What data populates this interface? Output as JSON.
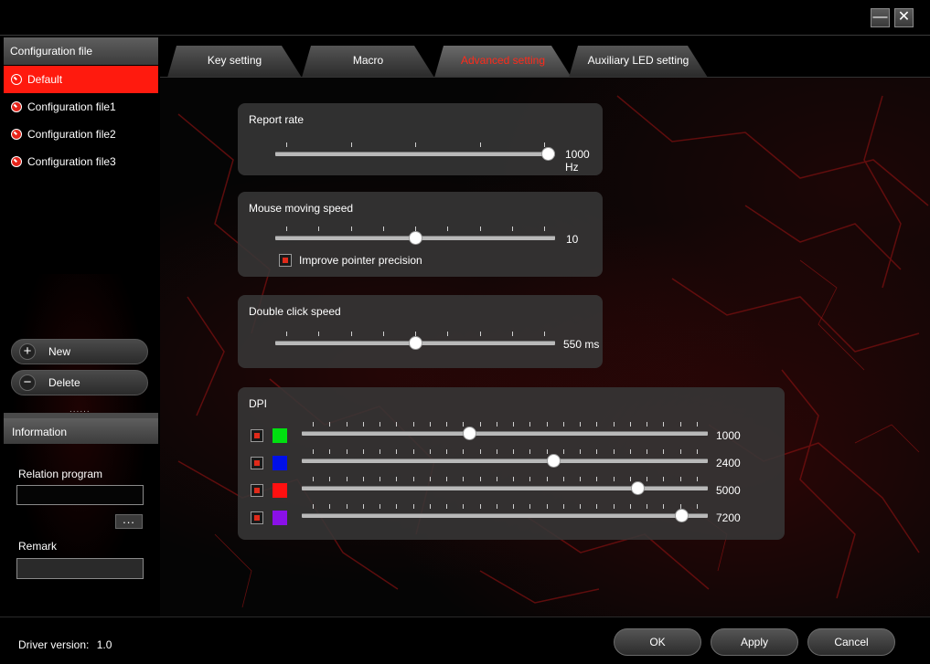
{
  "window": {
    "minimize_label": "—",
    "close_label": "✕"
  },
  "sidebar": {
    "header": "Configuration file",
    "items": [
      {
        "label": "Default",
        "active": true
      },
      {
        "label": "Configuration file1",
        "active": false
      },
      {
        "label": "Configuration file2",
        "active": false
      },
      {
        "label": "Configuration file3",
        "active": false
      }
    ],
    "new_label": "New",
    "delete_label": "Delete",
    "new_icon": "+",
    "delete_icon": "−"
  },
  "information": {
    "header": "Information",
    "relation_label": "Relation program",
    "relation_value": "",
    "browse_label": "...",
    "remark_label": "Remark",
    "remark_value": ""
  },
  "footer": {
    "driver_label": "Driver version:",
    "driver_value": "1.0",
    "ok_label": "OK",
    "apply_label": "Apply",
    "cancel_label": "Cancel"
  },
  "tabs": [
    {
      "label": "Key setting",
      "active": false
    },
    {
      "label": "Macro",
      "active": false
    },
    {
      "label": "Advanced setting",
      "active": true
    },
    {
      "label": "Auxiliary LED setting",
      "active": false
    }
  ],
  "report_rate": {
    "title": "Report rate",
    "value_label": "1000 Hz",
    "level": 1.0
  },
  "mouse_speed": {
    "title": "Mouse moving speed",
    "value_label": "10",
    "level": 0.5,
    "precision_label": "Improve pointer precision",
    "precision_checked": true
  },
  "double_click": {
    "title": "Double click speed",
    "value_label": "550 ms",
    "level": 0.5
  },
  "dpi": {
    "title": "DPI",
    "levels": [
      {
        "value_label": "1000",
        "color": "#00e010",
        "checked": true,
        "level": 0.41
      },
      {
        "value_label": "2400",
        "color": "#0010e8",
        "checked": true,
        "level": 0.625
      },
      {
        "value_label": "5000",
        "color": "#ff1010",
        "checked": true,
        "level": 0.84
      },
      {
        "value_label": "7200",
        "color": "#8a10e8",
        "checked": true,
        "level": 0.95
      }
    ]
  }
}
